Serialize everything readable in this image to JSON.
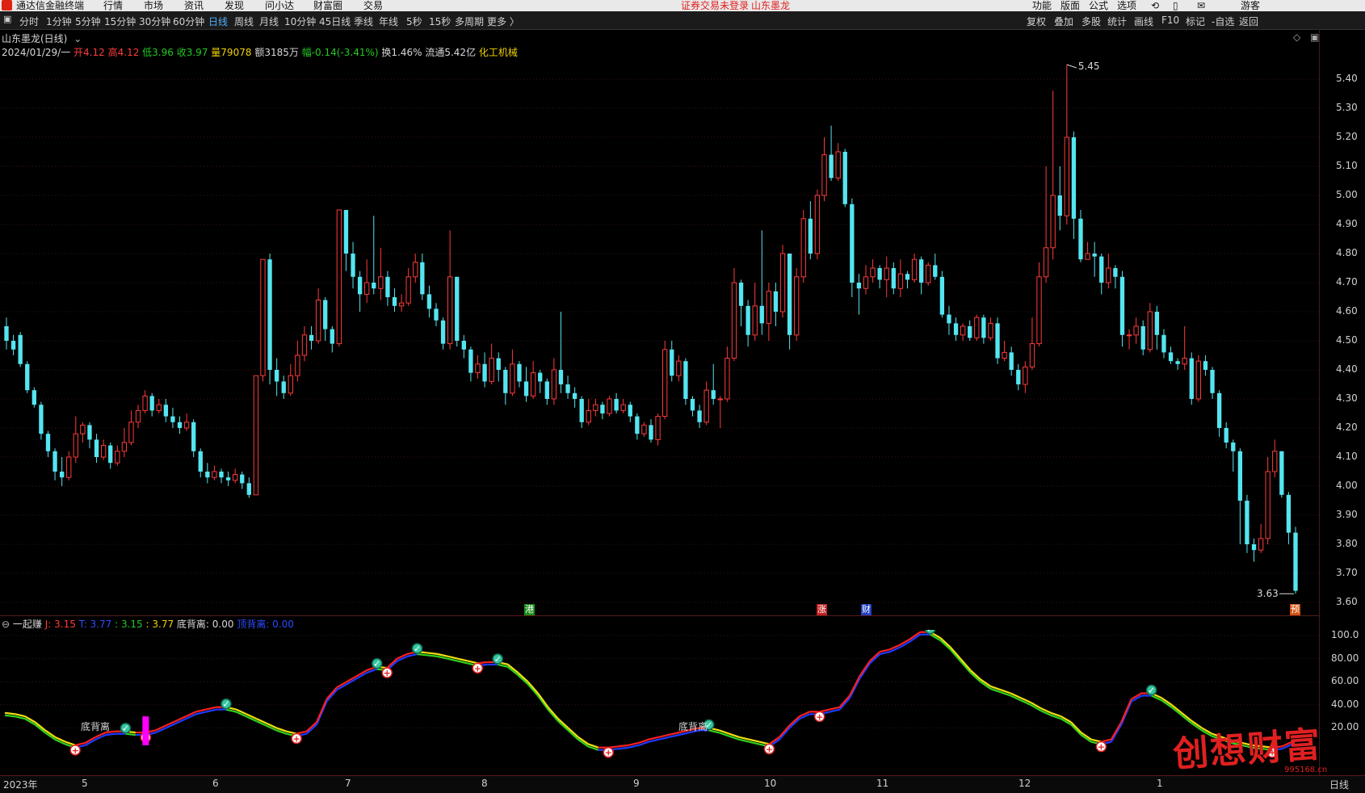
{
  "menubar": {
    "app_name": "通达信金融终端",
    "menus": [
      "行情",
      "市场",
      "资讯",
      "发现",
      "问小达",
      "财富圈",
      "交易"
    ],
    "notice": "证券交易未登录",
    "notice_stock": "山东墨龙",
    "right_menus": [
      "功能",
      "版面",
      "公式",
      "选项"
    ],
    "guest": "游客"
  },
  "toolbar": {
    "periods": [
      "分时",
      "1分钟",
      "5分钟",
      "15分钟",
      "30分钟",
      "60分钟",
      "日线",
      "周线",
      "月线",
      "10分钟",
      "45日线",
      "季线",
      "年线",
      "5秒",
      "15秒",
      "多周期",
      "更多 〉"
    ],
    "active_period": "日线",
    "right_tools": [
      "复权",
      "叠加",
      "多股",
      "统计",
      "画线",
      "F10",
      "标记",
      "-自选",
      "返回"
    ]
  },
  "stock": {
    "title": "山东墨龙(日线)",
    "date": "2024/01/29/一",
    "open_label": "开4.12",
    "high_label": "高4.12",
    "low_label": "低3.96",
    "close_label": "收3.97",
    "volume_label": "量79078",
    "amount_label": "额3185万",
    "change_label": "幅-0.14(-3.41%)",
    "turnover_label": "换1.46%",
    "float_label": "流通5.42亿",
    "industry": "化工机械",
    "high_mark": "5.45",
    "low_mark": "3.63"
  },
  "price_axis": [
    "5.40",
    "5.30",
    "5.20",
    "5.10",
    "5.00",
    "4.90",
    "4.80",
    "4.70",
    "4.60",
    "4.50",
    "4.40",
    "4.30",
    "4.20",
    "4.10",
    "4.00",
    "3.90",
    "3.80",
    "3.70",
    "3.60"
  ],
  "event_markers": [
    {
      "text": "港",
      "color": "#1a8c1a"
    },
    {
      "text": "涨",
      "color": "#c02020"
    },
    {
      "text": "财",
      "color": "#2040c0"
    },
    {
      "text": "预",
      "color": "#d05010"
    }
  ],
  "indicator": {
    "name": "一起赚",
    "j_label": "J: 3.15",
    "t_label": "T: 3.77",
    "v1_label": ": 3.15",
    "v2_label": ": 3.77",
    "dbl_label": "底背离: 0.00",
    "dbl2_label": "顶背离: 0.00",
    "divergence_label": "底背离",
    "axis": [
      "100.0",
      "80.00",
      "60.00",
      "40.00",
      "20.00"
    ]
  },
  "x_axis": [
    "2023年",
    "5",
    "6",
    "7",
    "8",
    "9",
    "10",
    "11",
    "12",
    "1"
  ],
  "period_label": "日线",
  "watermark": "创想财富",
  "watermark_url": "995168.cn",
  "colors": {
    "up": "#ff3b3b",
    "down": "#54e5f0",
    "grid": "#3a1515"
  },
  "chart_data": {
    "type": "candlestick",
    "ylim": [
      3.58,
      5.5
    ],
    "candles": [
      [
        4.55,
        4.5,
        4.58,
        4.47
      ],
      [
        4.5,
        4.47,
        4.52,
        4.45
      ],
      [
        4.52,
        4.42,
        4.53,
        4.41
      ],
      [
        4.42,
        4.33,
        4.43,
        4.32
      ],
      [
        4.33,
        4.28,
        4.34,
        4.27
      ],
      [
        4.28,
        4.18,
        4.29,
        4.16
      ],
      [
        4.18,
        4.12,
        4.19,
        4.1
      ],
      [
        4.12,
        4.05,
        4.13,
        4.02
      ],
      [
        4.05,
        4.03,
        4.1,
        4.0
      ],
      [
        4.03,
        4.1,
        4.12,
        4.02
      ],
      [
        4.1,
        4.18,
        4.24,
        4.08
      ],
      [
        4.18,
        4.21,
        4.22,
        4.15
      ],
      [
        4.21,
        4.16,
        4.22,
        4.13
      ],
      [
        4.16,
        4.1,
        4.18,
        4.08
      ],
      [
        4.1,
        4.14,
        4.16,
        4.09
      ],
      [
        4.14,
        4.08,
        4.15,
        4.06
      ],
      [
        4.08,
        4.12,
        4.14,
        4.07
      ],
      [
        4.12,
        4.15,
        4.2,
        4.1
      ],
      [
        4.15,
        4.22,
        4.26,
        4.14
      ],
      [
        4.22,
        4.26,
        4.28,
        4.2
      ],
      [
        4.26,
        4.31,
        4.33,
        4.25
      ],
      [
        4.31,
        4.26,
        4.32,
        4.24
      ],
      [
        4.26,
        4.28,
        4.3,
        4.25
      ],
      [
        4.28,
        4.24,
        4.3,
        4.22
      ],
      [
        4.24,
        4.22,
        4.27,
        4.2
      ],
      [
        4.22,
        4.2,
        4.24,
        4.18
      ],
      [
        4.2,
        4.22,
        4.25,
        4.19
      ],
      [
        4.22,
        4.12,
        4.23,
        4.1
      ],
      [
        4.12,
        4.05,
        4.13,
        4.03
      ],
      [
        4.05,
        4.03,
        4.08,
        4.01
      ],
      [
        4.03,
        4.05,
        4.07,
        4.02
      ],
      [
        4.05,
        4.03,
        4.06,
        4.01
      ],
      [
        4.03,
        4.02,
        4.05,
        4.0
      ],
      [
        4.02,
        4.04,
        4.06,
        4.01
      ],
      [
        4.04,
        4.01,
        4.05,
        3.99
      ],
      [
        4.01,
        3.97,
        4.03,
        3.96
      ],
      [
        3.97,
        4.38,
        4.38,
        3.97
      ],
      [
        4.38,
        4.78,
        4.78,
        4.36
      ],
      [
        4.78,
        4.4,
        4.8,
        4.35
      ],
      [
        4.4,
        4.36,
        4.44,
        4.31
      ],
      [
        4.36,
        4.32,
        4.38,
        4.3
      ],
      [
        4.32,
        4.38,
        4.42,
        4.31
      ],
      [
        4.38,
        4.45,
        4.5,
        4.36
      ],
      [
        4.45,
        4.52,
        4.55,
        4.43
      ],
      [
        4.52,
        4.5,
        4.55,
        4.47
      ],
      [
        4.5,
        4.64,
        4.68,
        4.49
      ],
      [
        4.64,
        4.54,
        4.65,
        4.5
      ],
      [
        4.54,
        4.49,
        4.55,
        4.46
      ],
      [
        4.49,
        4.95,
        4.95,
        4.48
      ],
      [
        4.95,
        4.8,
        4.95,
        4.74
      ],
      [
        4.8,
        4.72,
        4.84,
        4.68
      ],
      [
        4.72,
        4.66,
        4.74,
        4.6
      ],
      [
        4.66,
        4.7,
        4.78,
        4.63
      ],
      [
        4.7,
        4.68,
        4.93,
        4.66
      ],
      [
        4.68,
        4.72,
        4.82,
        4.64
      ],
      [
        4.72,
        4.65,
        4.74,
        4.62
      ],
      [
        4.65,
        4.62,
        4.68,
        4.6
      ],
      [
        4.62,
        4.63,
        4.66,
        4.6
      ],
      [
        4.63,
        4.72,
        4.75,
        4.62
      ],
      [
        4.72,
        4.77,
        4.8,
        4.7
      ],
      [
        4.77,
        4.66,
        4.8,
        4.64
      ],
      [
        4.66,
        4.61,
        4.69,
        4.58
      ],
      [
        4.61,
        4.57,
        4.63,
        4.55
      ],
      [
        4.57,
        4.49,
        4.58,
        4.47
      ],
      [
        4.49,
        4.72,
        4.88,
        4.47
      ],
      [
        4.72,
        4.5,
        4.72,
        4.48
      ],
      [
        4.5,
        4.47,
        4.52,
        4.44
      ],
      [
        4.47,
        4.39,
        4.48,
        4.36
      ],
      [
        4.39,
        4.42,
        4.45,
        4.37
      ],
      [
        4.42,
        4.36,
        4.46,
        4.34
      ],
      [
        4.36,
        4.44,
        4.49,
        4.35
      ],
      [
        4.44,
        4.4,
        4.46,
        4.36
      ],
      [
        4.4,
        4.32,
        4.41,
        4.28
      ],
      [
        4.32,
        4.42,
        4.47,
        4.31
      ],
      [
        4.42,
        4.36,
        4.43,
        4.34
      ],
      [
        4.36,
        4.31,
        4.41,
        4.29
      ],
      [
        4.31,
        4.39,
        4.43,
        4.3
      ],
      [
        4.39,
        4.36,
        4.4,
        4.32
      ],
      [
        4.36,
        4.3,
        4.37,
        4.28
      ],
      [
        4.3,
        4.4,
        4.44,
        4.28
      ],
      [
        4.4,
        4.35,
        4.6,
        4.32
      ],
      [
        4.35,
        4.32,
        4.38,
        4.3
      ],
      [
        4.32,
        4.3,
        4.34,
        4.27
      ],
      [
        4.3,
        4.22,
        4.31,
        4.2
      ],
      [
        4.22,
        4.26,
        4.3,
        4.21
      ],
      [
        4.26,
        4.28,
        4.3,
        4.24
      ],
      [
        4.28,
        4.25,
        4.29,
        4.23
      ],
      [
        4.25,
        4.3,
        4.31,
        4.24
      ],
      [
        4.3,
        4.26,
        4.32,
        4.25
      ],
      [
        4.26,
        4.28,
        4.3,
        4.25
      ],
      [
        4.28,
        4.24,
        4.29,
        4.22
      ],
      [
        4.24,
        4.18,
        4.25,
        4.16
      ],
      [
        4.18,
        4.21,
        4.22,
        4.17
      ],
      [
        4.21,
        4.16,
        4.23,
        4.15
      ],
      [
        4.16,
        4.24,
        4.25,
        4.14
      ],
      [
        4.24,
        4.47,
        4.5,
        4.23
      ],
      [
        4.47,
        4.38,
        4.5,
        4.36
      ],
      [
        4.38,
        4.43,
        4.45,
        4.36
      ],
      [
        4.43,
        4.3,
        4.44,
        4.28
      ],
      [
        4.3,
        4.26,
        4.31,
        4.24
      ],
      [
        4.26,
        4.22,
        4.28,
        4.2
      ],
      [
        4.22,
        4.33,
        4.36,
        4.21
      ],
      [
        4.33,
        4.3,
        4.42,
        4.28
      ],
      [
        4.3,
        4.3,
        4.31,
        4.2
      ],
      [
        4.3,
        4.44,
        4.48,
        4.29
      ],
      [
        4.44,
        4.7,
        4.75,
        4.43
      ],
      [
        4.7,
        4.62,
        4.71,
        4.55
      ],
      [
        4.62,
        4.52,
        4.64,
        4.48
      ],
      [
        4.52,
        4.62,
        4.7,
        4.5
      ],
      [
        4.62,
        4.56,
        4.88,
        4.52
      ],
      [
        4.56,
        4.67,
        4.7,
        4.5
      ],
      [
        4.67,
        4.6,
        4.7,
        4.55
      ],
      [
        4.6,
        4.8,
        4.83,
        4.58
      ],
      [
        4.8,
        4.52,
        4.8,
        4.47
      ],
      [
        4.52,
        4.72,
        4.75,
        4.5
      ],
      [
        4.72,
        4.92,
        4.95,
        4.7
      ],
      [
        4.92,
        4.8,
        4.98,
        4.78
      ],
      [
        4.8,
        5.0,
        5.02,
        4.78
      ],
      [
        5.0,
        5.14,
        5.2,
        4.98
      ],
      [
        5.14,
        5.06,
        5.24,
        5.05
      ],
      [
        5.06,
        5.15,
        5.18,
        5.05
      ],
      [
        5.15,
        4.97,
        5.16,
        4.96
      ],
      [
        4.97,
        4.7,
        4.99,
        4.65
      ],
      [
        4.7,
        4.68,
        4.73,
        4.59
      ],
      [
        4.68,
        4.72,
        4.76,
        4.66
      ],
      [
        4.72,
        4.75,
        4.78,
        4.7
      ],
      [
        4.75,
        4.71,
        4.76,
        4.68
      ],
      [
        4.71,
        4.75,
        4.79,
        4.65
      ],
      [
        4.75,
        4.68,
        4.77,
        4.66
      ],
      [
        4.68,
        4.73,
        4.78,
        4.65
      ],
      [
        4.73,
        4.71,
        4.74,
        4.68
      ],
      [
        4.71,
        4.78,
        4.8,
        4.7
      ],
      [
        4.78,
        4.7,
        4.79,
        4.66
      ],
      [
        4.7,
        4.76,
        4.77,
        4.69
      ],
      [
        4.76,
        4.72,
        4.8,
        4.71
      ],
      [
        4.72,
        4.59,
        4.74,
        4.58
      ],
      [
        4.59,
        4.56,
        4.62,
        4.52
      ],
      [
        4.56,
        4.52,
        4.58,
        4.5
      ],
      [
        4.52,
        4.55,
        4.56,
        4.5
      ],
      [
        4.55,
        4.51,
        4.57,
        4.5
      ],
      [
        4.51,
        4.58,
        4.59,
        4.5
      ],
      [
        4.58,
        4.51,
        4.59,
        4.49
      ],
      [
        4.51,
        4.56,
        4.58,
        4.5
      ],
      [
        4.56,
        4.44,
        4.58,
        4.42
      ],
      [
        4.44,
        4.46,
        4.5,
        4.43
      ],
      [
        4.46,
        4.4,
        4.48,
        4.38
      ],
      [
        4.4,
        4.35,
        4.42,
        4.33
      ],
      [
        4.35,
        4.41,
        4.43,
        4.32
      ],
      [
        4.41,
        4.49,
        4.58,
        4.4
      ],
      [
        4.49,
        4.72,
        4.77,
        4.48
      ],
      [
        4.72,
        4.82,
        5.1,
        4.7
      ],
      [
        4.82,
        5.0,
        5.36,
        4.78
      ],
      [
        5.0,
        4.93,
        5.1,
        4.88
      ],
      [
        4.93,
        5.2,
        5.45,
        4.9
      ],
      [
        5.2,
        4.92,
        5.22,
        4.85
      ],
      [
        4.92,
        4.78,
        4.95,
        4.77
      ],
      [
        4.78,
        4.8,
        4.84,
        4.78
      ],
      [
        4.8,
        4.79,
        4.84,
        4.72
      ],
      [
        4.79,
        4.7,
        4.8,
        4.66
      ],
      [
        4.7,
        4.75,
        4.8,
        4.68
      ],
      [
        4.75,
        4.72,
        4.76,
        4.68
      ],
      [
        4.72,
        4.52,
        4.74,
        4.48
      ],
      [
        4.52,
        4.52,
        4.54,
        4.47
      ],
      [
        4.52,
        4.55,
        4.58,
        4.49
      ],
      [
        4.55,
        4.47,
        4.57,
        4.45
      ],
      [
        4.47,
        4.6,
        4.63,
        4.46
      ],
      [
        4.6,
        4.52,
        4.62,
        4.47
      ],
      [
        4.52,
        4.46,
        4.54,
        4.44
      ],
      [
        4.46,
        4.43,
        4.48,
        4.42
      ],
      [
        4.43,
        4.42,
        4.44,
        4.4
      ],
      [
        4.42,
        4.44,
        4.55,
        4.4
      ],
      [
        4.44,
        4.3,
        4.46,
        4.28
      ],
      [
        4.3,
        4.43,
        4.45,
        4.29
      ],
      [
        4.43,
        4.4,
        4.45,
        4.38
      ],
      [
        4.4,
        4.32,
        4.41,
        4.3
      ],
      [
        4.32,
        4.2,
        4.33,
        4.17
      ],
      [
        4.2,
        4.15,
        4.22,
        4.13
      ],
      [
        4.15,
        4.12,
        4.16,
        4.05
      ],
      [
        4.12,
        3.95,
        4.13,
        3.8
      ],
      [
        3.95,
        3.8,
        3.97,
        3.77
      ],
      [
        3.8,
        3.78,
        3.82,
        3.74
      ],
      [
        3.78,
        3.82,
        3.87,
        3.77
      ],
      [
        3.82,
        4.05,
        4.1,
        3.8
      ],
      [
        4.05,
        4.12,
        4.16,
        4.03
      ],
      [
        4.12,
        3.97,
        4.12,
        3.96
      ],
      [
        3.97,
        3.84,
        3.98,
        3.8
      ],
      [
        3.84,
        3.64,
        3.86,
        3.63
      ]
    ]
  },
  "oscillator_data": {
    "type": "line",
    "ylim": [
      0,
      110
    ],
    "values": [
      33,
      32,
      30,
      25,
      18,
      12,
      8,
      5,
      7,
      12,
      16,
      17,
      17,
      16,
      16,
      18,
      22,
      26,
      30,
      34,
      36,
      38,
      38,
      36,
      32,
      28,
      24,
      20,
      17,
      15,
      17,
      25,
      45,
      55,
      60,
      65,
      70,
      73,
      72,
      80,
      84,
      86,
      85,
      84,
      82,
      80,
      78,
      76,
      77,
      77,
      75,
      68,
      60,
      50,
      38,
      28,
      20,
      12,
      6,
      3,
      3,
      4,
      5,
      7,
      10,
      12,
      14,
      16,
      18,
      20,
      20,
      18,
      15,
      12,
      10,
      8,
      6,
      12,
      22,
      30,
      34,
      34,
      36,
      38,
      48,
      65,
      78,
      86,
      88,
      92,
      97,
      103,
      103,
      98,
      90,
      80,
      70,
      62,
      56,
      53,
      50,
      46,
      42,
      37,
      33,
      30,
      25,
      16,
      10,
      8,
      10,
      25,
      45,
      50,
      50,
      46,
      40,
      33,
      26,
      20,
      15,
      12,
      9,
      7,
      5,
      4,
      3,
      4,
      8
    ]
  }
}
